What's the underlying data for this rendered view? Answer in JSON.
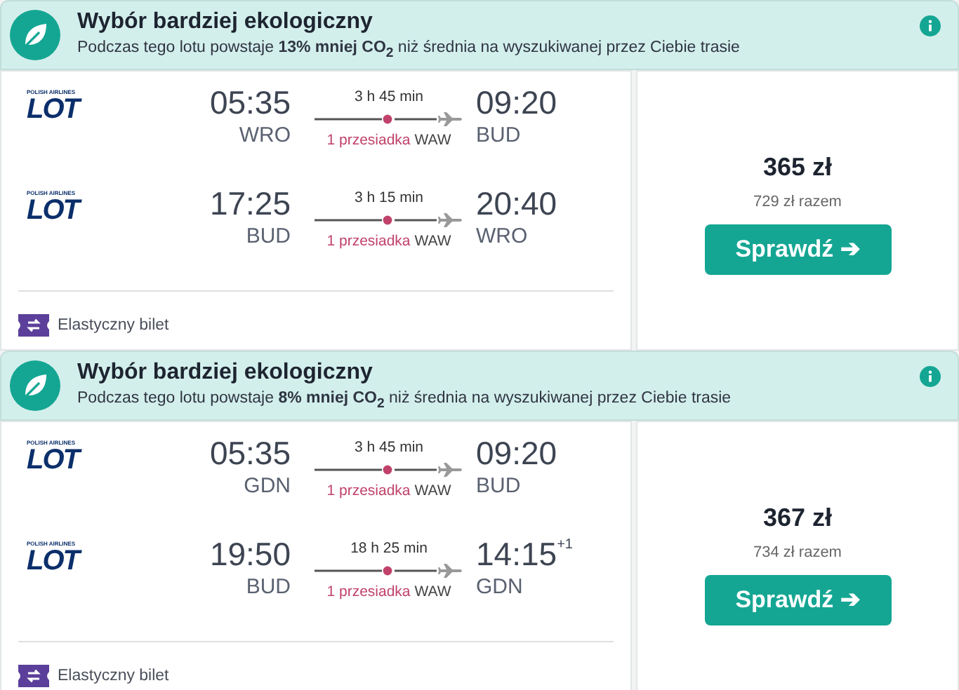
{
  "offers": [
    {
      "eco": {
        "title": "Wybór bardziej ekologiczny",
        "text": "Podczas tego lotu powstaje **13% mniej CO$_{2}$** niż średnia na wyszukiwanej przez Ciebie trasie"
      },
      "legs": [
        {
          "logo_caption": "POLISH AIRLINES",
          "logo": "LOT",
          "dep_time": "05:35",
          "dep_airport": "WRO",
          "duration": "3 h 45 min",
          "stops": "1 przesiadka",
          "via": "WAW",
          "arr_time": "09:20",
          "arr_airport": "BUD"
        },
        {
          "logo_caption": "POLISH AIRLINES",
          "logo": "LOT",
          "dep_time": "17:25",
          "dep_airport": "BUD",
          "duration": "3 h 15 min",
          "stops": "1 przesiadka",
          "via": "WAW",
          "arr_time": "20:40",
          "arr_airport": "WRO"
        }
      ],
      "flex_label": "Elastyczny bilet",
      "price": "365 zł",
      "total": "729 zł razem",
      "button": "Sprawdź ➔"
    },
    {
      "eco": {
        "title": "Wybór bardziej ekologiczny",
        "text": "Podczas tego lotu powstaje **8% mniej CO$_{2}$** niż średnia na wyszukiwanej przez Ciebie trasie"
      },
      "legs": [
        {
          "logo_caption": "POLISH AIRLINES",
          "logo": "LOT",
          "dep_time": "05:35",
          "dep_airport": "GDN",
          "duration": "3 h 45 min",
          "stops": "1 przesiadka",
          "via": "WAW",
          "arr_time": "09:20",
          "arr_airport": "BUD"
        },
        {
          "logo_caption": "POLISH AIRLINES",
          "logo": "LOT",
          "dep_time": "19:50",
          "dep_airport": "BUD",
          "duration": "18 h 25 min",
          "stops": "1 przesiadka",
          "via": "WAW",
          "arr_time": "14:15",
          "arr_day_offset": "+1",
          "arr_airport": "GDN"
        }
      ],
      "flex_label": "Elastyczny bilet",
      "price": "367 zł",
      "total": "734 zł razem",
      "button": "Sprawdź ➔"
    }
  ]
}
